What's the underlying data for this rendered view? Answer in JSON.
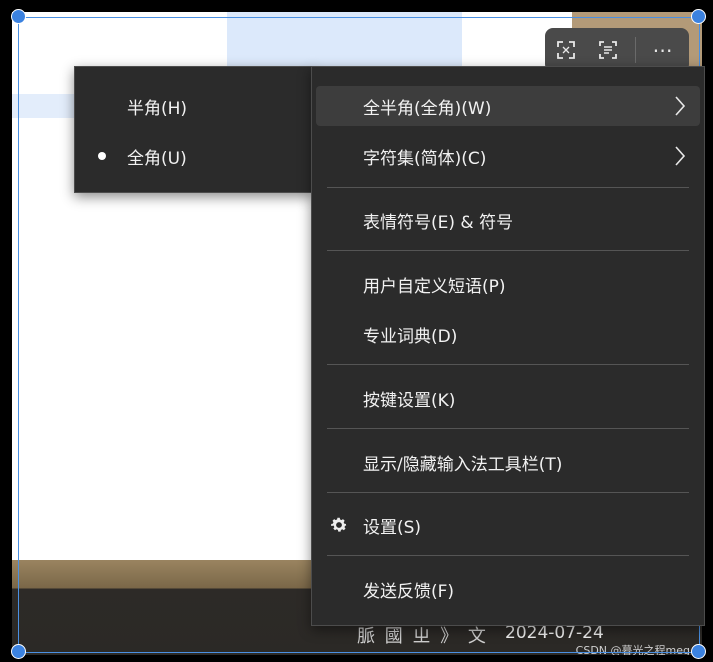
{
  "background": {
    "date_text": "2024-07-24",
    "partial_text": "脈 國 ㄓ 》 文",
    "watermark": "CSDN @暮光之程meg"
  },
  "toolbar": {
    "items": [
      {
        "icon": "expand-icon"
      },
      {
        "icon": "scan-text-icon"
      },
      {
        "icon": "more-icon",
        "label": "⋯"
      }
    ]
  },
  "submenu": {
    "items": [
      {
        "label": "半角(H)",
        "selected": false
      },
      {
        "label": "全角(U)",
        "selected": true
      }
    ]
  },
  "menu": {
    "items": [
      {
        "label": "全半角(全角)(W)",
        "has_submenu": true,
        "highlighted": true
      },
      {
        "label": "字符集(简体)(C)",
        "has_submenu": true
      },
      {
        "label": "表情符号(E) & 符号"
      },
      {
        "label": "用户自定义短语(P)"
      },
      {
        "label": "专业词典(D)"
      },
      {
        "label": "按键设置(K)"
      },
      {
        "label": "显示/隐藏输入法工具栏(T)"
      },
      {
        "label": "设置(S)",
        "icon": "gear-icon"
      },
      {
        "label": "发送反馈(F)"
      }
    ]
  },
  "colors": {
    "menu_bg": "#2b2b2b",
    "menu_highlight": "#3d3d3d",
    "text": "#f2f2f2",
    "selection_border": "#4a90e2"
  }
}
